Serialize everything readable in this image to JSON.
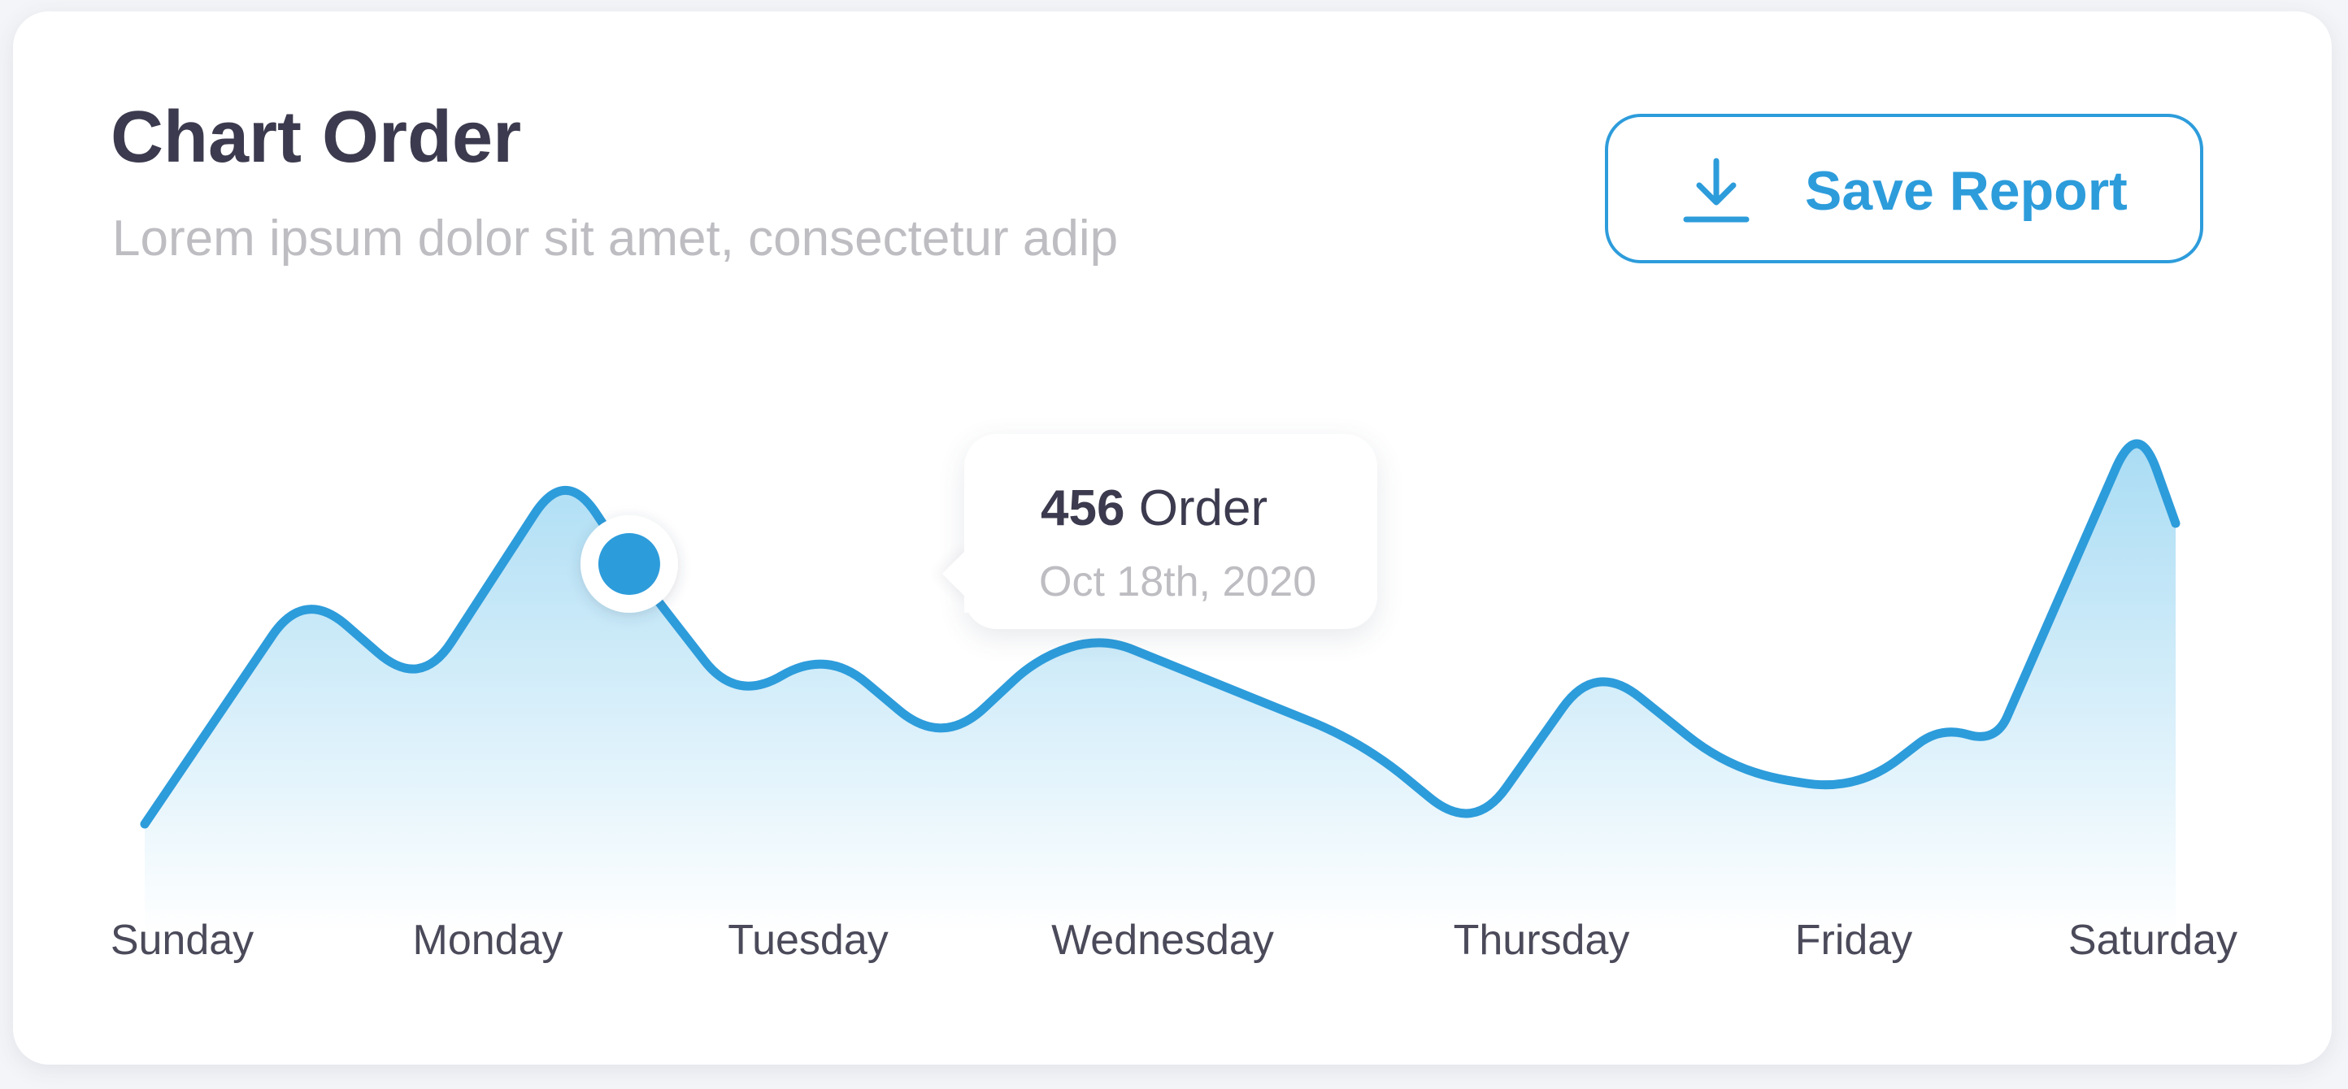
{
  "header": {
    "title": "Chart Order",
    "subtitle": "Lorem ipsum dolor sit amet, consectetur adip"
  },
  "actions": {
    "save_label": "Save Report",
    "save_icon": "download-icon"
  },
  "tooltip": {
    "value": "456",
    "unit": "Order",
    "date": "Oct 18th, 2020"
  },
  "colors": {
    "accent": "#2d9cdb",
    "title": "#3b3a4e",
    "muted": "#bdbdc2",
    "area_top": "#a9dcf4",
    "area_bottom": "#ffffff"
  },
  "chart_data": {
    "type": "area",
    "categories": [
      "Sunday",
      "Monday",
      "Tuesday",
      "Wednesday",
      "Thursday",
      "Friday",
      "Saturday"
    ],
    "x": [
      0,
      0.55,
      0.95,
      1.45,
      1.67,
      2.04,
      2.35,
      2.75,
      3.08,
      3.3,
      4.2,
      4.58,
      5.0,
      5.47,
      5.9,
      6.19,
      6.38,
      6.87,
      7.0
    ],
    "values": [
      50,
      340,
      215,
      490,
      370,
      200,
      265,
      145,
      255,
      280,
      150,
      38,
      250,
      115,
      90,
      170,
      150,
      550,
      420
    ],
    "highlight": {
      "index": 4,
      "value": 456
    },
    "grid": false,
    "legend": "none",
    "ylim": [
      0,
      600
    ]
  }
}
